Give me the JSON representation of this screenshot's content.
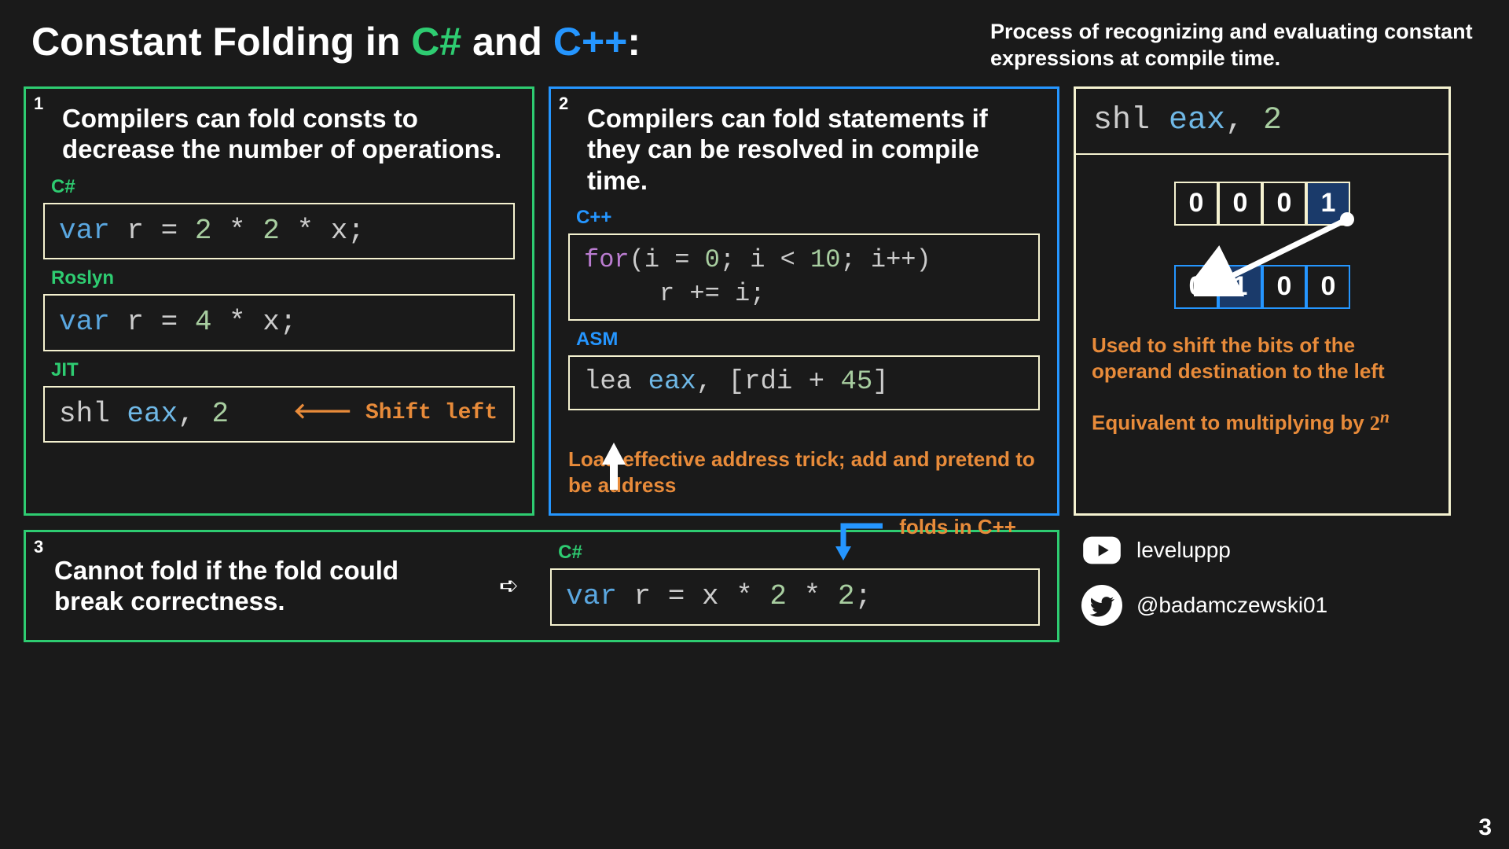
{
  "header": {
    "title_pre": "Constant Folding in ",
    "title_csharp": "C#",
    "title_mid": " and ",
    "title_cpp": "C++",
    "title_post": ":",
    "subtitle": "Process of recognizing and evaluating constant expressions at compile time."
  },
  "panel1": {
    "num": "1",
    "heading": "Compilers can fold consts to decrease the number of operations.",
    "label_csharp": "C#",
    "code_csharp": {
      "var": "var",
      "r": " r ",
      "eq": "= ",
      "two1": "2",
      "mul1": " * ",
      "two2": "2",
      "mul2": " * ",
      "x": "x",
      "semi": ";"
    },
    "label_roslyn": "Roslyn",
    "code_roslyn": {
      "var": "var",
      "r": " r ",
      "eq": "= ",
      "four": "4",
      "mul": " * ",
      "x": "x",
      "semi": ";"
    },
    "label_jit": "JIT",
    "code_jit": {
      "shl": "shl ",
      "eax": "eax",
      "comma": ", ",
      "two": "2"
    },
    "shiftleft_label": "Shift left"
  },
  "panel2": {
    "num": "2",
    "heading": "Compilers can fold statements if they can be resolved in compile time.",
    "label_cpp": "C++",
    "code_cpp_line1": "for(i = 0; i < 10; i++)",
    "code_cpp_line2": "     r += i;",
    "label_asm": "ASM",
    "code_asm": {
      "lea": "lea ",
      "eax": "eax",
      "comma": ", ",
      "br": "[rdi + ",
      "fortyfive": "45",
      "cl": "]"
    },
    "note": "Load effective address trick; add and pretend to be address"
  },
  "panel3": {
    "num": "3",
    "heading": "Cannot fold if the fold could break correctness.",
    "label_csharp": "C#",
    "code": {
      "var": "var",
      "r": " r ",
      "eq": "= ",
      "x": "x",
      "mul1": " * ",
      "two1": "2",
      "mul2": " * ",
      "two2": "2",
      "semi": ";"
    },
    "folds_note": "folds in C++"
  },
  "side": {
    "code": {
      "shl": "shl ",
      "eax": "eax",
      "comma": ", ",
      "two": "2"
    },
    "bits_top": [
      "0",
      "0",
      "0",
      "1"
    ],
    "bits_bot": [
      "0",
      "1",
      "0",
      "0"
    ],
    "note1": "Used to shift the bits of the operand destination to the left",
    "note2_pre": "Equivalent to multiplying by ",
    "note2_math": "2",
    "note2_sup": "n"
  },
  "socials": {
    "youtube": "leveluppp",
    "twitter": "@badamczewski01"
  },
  "pagenum": "3"
}
